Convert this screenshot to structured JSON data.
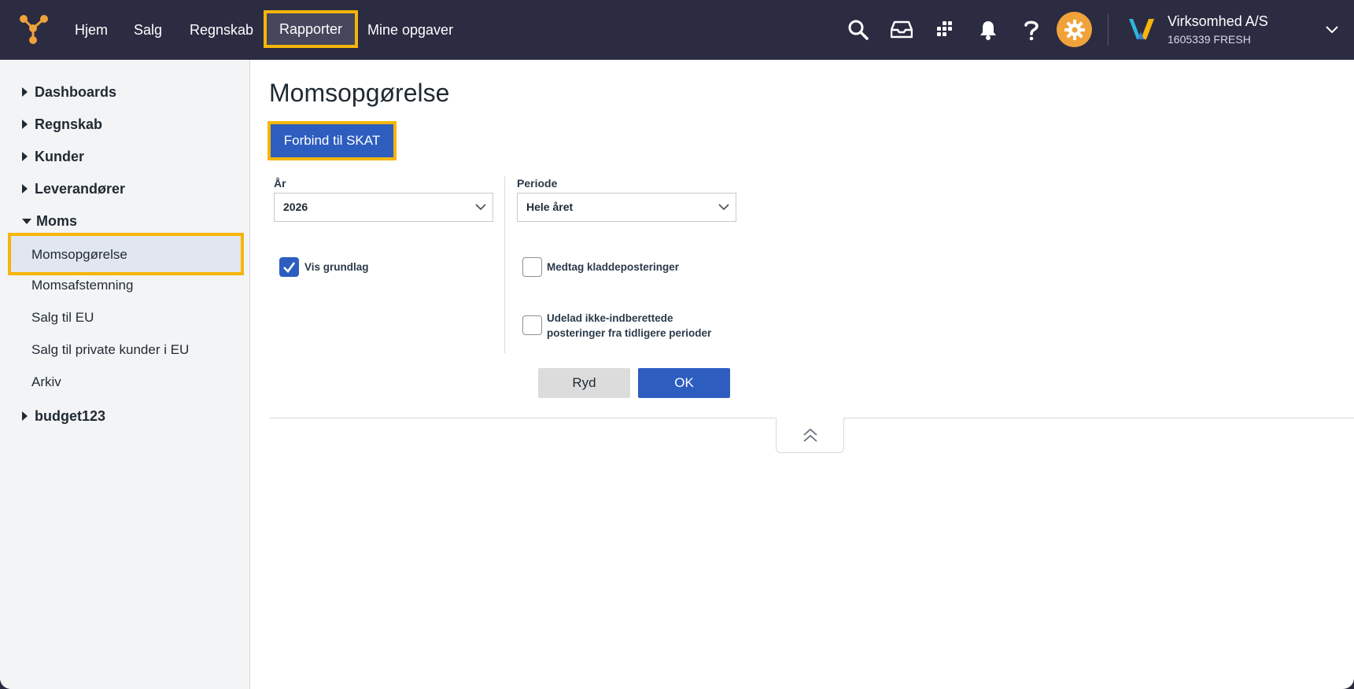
{
  "topbar": {
    "nav": [
      {
        "label": "Hjem"
      },
      {
        "label": "Salg"
      },
      {
        "label": "Regnskab"
      },
      {
        "label": "Rapporter",
        "active": true
      },
      {
        "label": "Mine opgaver"
      }
    ],
    "icons": [
      "search-icon",
      "inbox-icon",
      "apps-grid-icon",
      "bell-icon",
      "help-icon",
      "gear-icon"
    ],
    "company": {
      "name": "Virksomhed A/S",
      "sub": "1605339 FRESH"
    },
    "colors": {
      "bar": "#2b2b42",
      "highlight": "#f5b50a",
      "gear": "#f0a23a"
    }
  },
  "sidebar": {
    "groups": [
      {
        "label": "Dashboards",
        "expanded": false
      },
      {
        "label": "Regnskab",
        "expanded": false
      },
      {
        "label": "Kunder",
        "expanded": false
      },
      {
        "label": "Leverandører",
        "expanded": false
      },
      {
        "label": "Moms",
        "expanded": true
      }
    ],
    "items": [
      {
        "label": "Momsopgørelse",
        "selected": true
      },
      {
        "label": "Momsafstemning"
      },
      {
        "label": "Salg til EU"
      },
      {
        "label": "Salg til private kunder i EU"
      },
      {
        "label": "Arkiv"
      }
    ],
    "last_group": {
      "label": "budget123",
      "expanded": false
    }
  },
  "main": {
    "title": "Momsopgørelse",
    "skat_button": "Forbind til SKAT",
    "year": {
      "label": "År",
      "value": "2026"
    },
    "period": {
      "label": "Periode",
      "value": "Hele året"
    },
    "checkboxes": {
      "vis_grundlag": {
        "label": "Vis grundlag",
        "checked": true
      },
      "medtag": {
        "label": "Medtag kladdeposteringer",
        "checked": false
      },
      "udelad": {
        "line1": "Udelad ikke-indberettede",
        "line2": "posteringer fra tidligere perioder",
        "checked": false
      }
    },
    "buttons": {
      "clear": "Ryd",
      "ok": "OK"
    },
    "accent": "#2d5dbf"
  }
}
